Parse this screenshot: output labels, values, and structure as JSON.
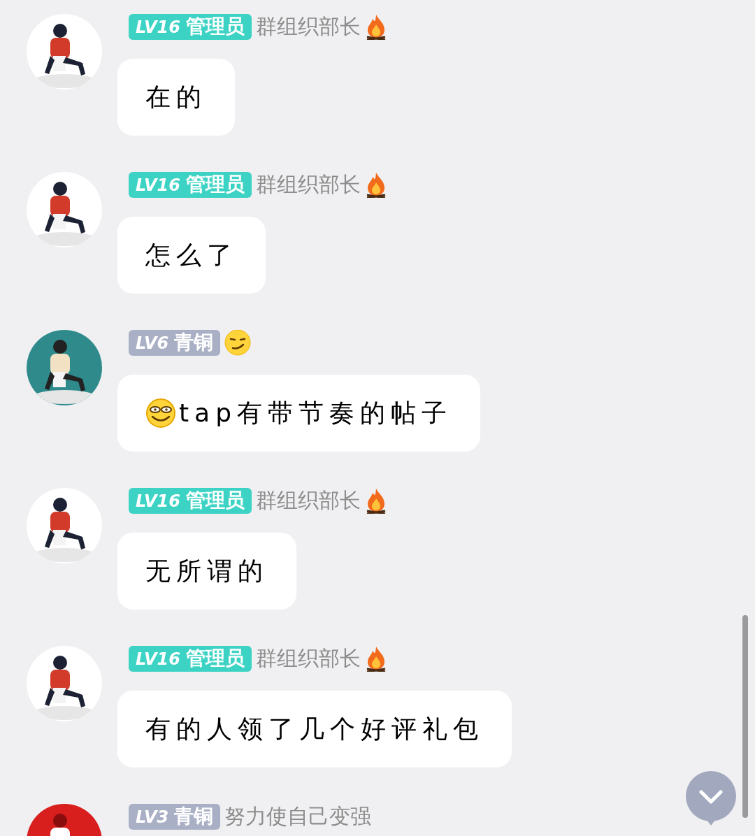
{
  "messages": [
    {
      "badge": {
        "level": "LV16",
        "role": "管理员",
        "color": "#3dd3c4"
      },
      "title": "群组织部长",
      "emblem": {
        "kind": "fire"
      },
      "text": "在的",
      "leading_emoji": false
    },
    {
      "badge": {
        "level": "LV16",
        "role": "管理员",
        "color": "#3dd3c4"
      },
      "title": "群组织部长",
      "emblem": {
        "kind": "fire"
      },
      "text": "怎么了",
      "leading_emoji": false
    },
    {
      "badge": {
        "level": "LV6",
        "role": "青铜",
        "color": "#a9afc4"
      },
      "emblem": {
        "kind": "smirk"
      },
      "text": "tap有带节奏的帖子",
      "leading_emoji": true
    },
    {
      "badge": {
        "level": "LV16",
        "role": "管理员",
        "color": "#3dd3c4"
      },
      "title": "群组织部长",
      "emblem": {
        "kind": "fire"
      },
      "text": "无所谓的",
      "leading_emoji": false
    },
    {
      "badge": {
        "level": "LV16",
        "role": "管理员",
        "color": "#3dd3c4"
      },
      "title": "群组织部长",
      "emblem": {
        "kind": "fire"
      },
      "text": "有的人领了几个好评礼包",
      "leading_emoji": false
    },
    {
      "badge": {
        "level": "LV3",
        "role": "青铜",
        "color": "#a9afc4"
      },
      "title": "努力使自己变强"
    }
  ]
}
